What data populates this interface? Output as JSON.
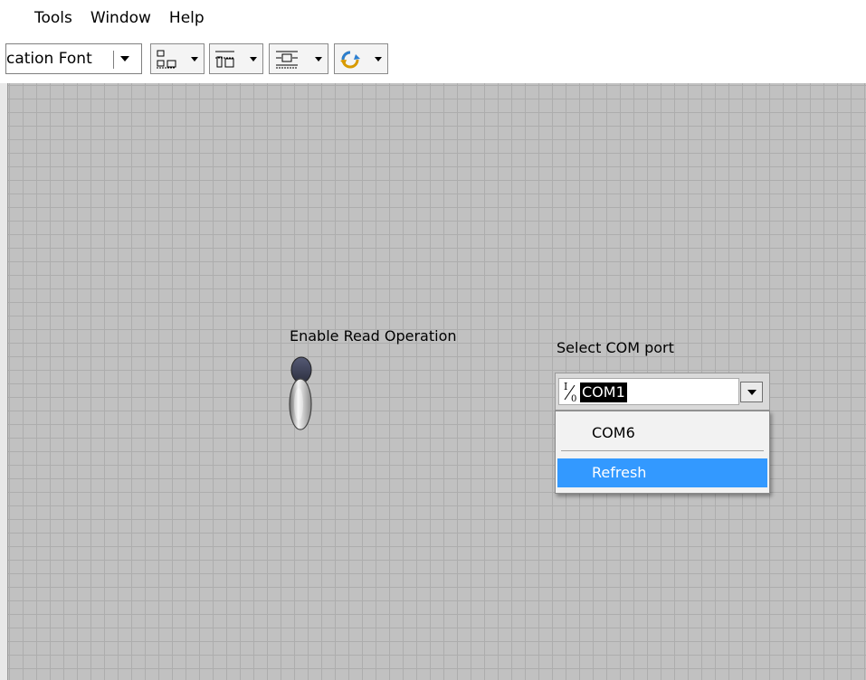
{
  "menubar": {
    "items": [
      "Tools",
      "Window",
      "Help"
    ]
  },
  "toolbar": {
    "font_combo_text": "cation Font",
    "buttons": [
      "align-objects",
      "distribute-objects",
      "resize-objects",
      "reorder-objects"
    ]
  },
  "front_panel": {
    "toggle": {
      "label": "Enable Read Operation",
      "state": "off"
    },
    "com_port": {
      "label": "Select COM port",
      "io_icon": "I/0",
      "value": "COM1",
      "options": [
        "COM6",
        "Refresh"
      ],
      "highlighted_option": "Refresh"
    }
  },
  "colors": {
    "canvas": "#c1c1c1",
    "grid_line": "#adadad",
    "highlight": "#3399ff"
  }
}
